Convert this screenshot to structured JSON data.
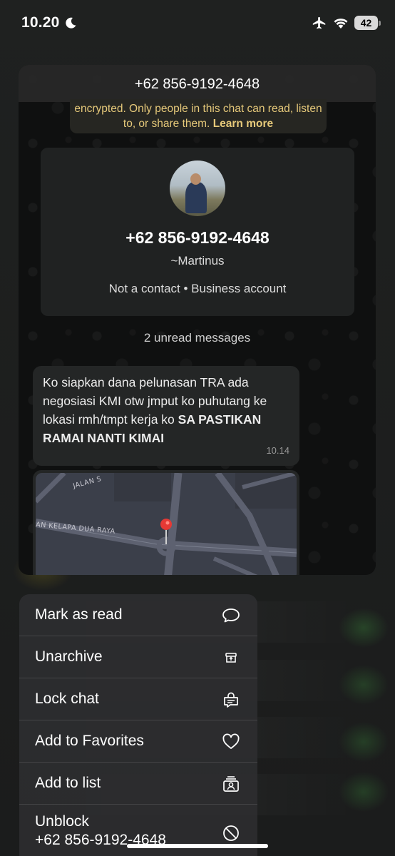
{
  "status_bar": {
    "time": "10.20",
    "battery": "42",
    "icons": [
      "moon-icon",
      "airplane-icon",
      "wifi-icon",
      "battery-icon"
    ]
  },
  "chat": {
    "header_title": "+62 856-9192-4648",
    "encryption_text": "encrypted. Only people in this chat can read, listen to, or share them.",
    "encryption_link": "Learn more",
    "contact": {
      "phone": "+62 856-9192-4648",
      "name": "~Martinus",
      "status": "Not a contact • Business account"
    },
    "unread_label": "2 unread messages",
    "message": {
      "text": "Ko siapkan dana pelunasan TRA ada negosiasi KMI otw jmput ko puhutang ke lokasi rmh/tmpt kerja ko ",
      "bold_text": "SA PASTIKAN RAMAI NANTI KIMAI",
      "time": "10.14"
    },
    "map": {
      "street_label_1": "JALAN S",
      "street_label_2": "AN KELAPA DUA RAYA"
    }
  },
  "menu": {
    "items": [
      {
        "label": "Mark as read",
        "icon": "chat-bubble-icon"
      },
      {
        "label": "Unarchive",
        "icon": "unarchive-icon"
      },
      {
        "label": "Lock chat",
        "icon": "lock-chat-icon"
      },
      {
        "label": "Add to Favorites",
        "icon": "heart-icon"
      },
      {
        "label": "Add to list",
        "icon": "list-person-icon"
      },
      {
        "label_line1": "Unblock",
        "label_line2": "+62 856-9192-4648",
        "icon": "block-icon"
      }
    ]
  },
  "colors": {
    "accent_link": "#e6c97a",
    "menu_bg": "#2c2c2e",
    "bubble_bg": "#242626"
  }
}
